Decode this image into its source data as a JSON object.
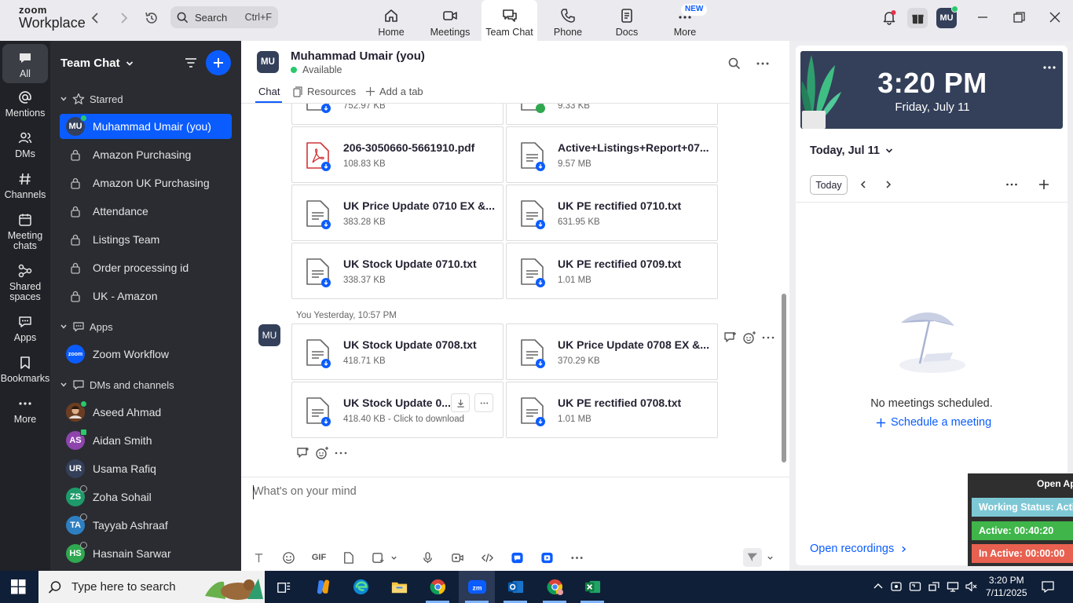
{
  "app": {
    "logo_line1": "zoom",
    "logo_line2": "Workplace",
    "search_placeholder": "Search",
    "search_shortcut": "Ctrl+F",
    "nav": [
      {
        "label": "Home",
        "icon": "home-icon"
      },
      {
        "label": "Meetings",
        "icon": "video-icon"
      },
      {
        "label": "Team Chat",
        "icon": "chat-icon",
        "active": true
      },
      {
        "label": "Phone",
        "icon": "phone-icon"
      },
      {
        "label": "Docs",
        "icon": "docs-icon"
      },
      {
        "label": "More",
        "icon": "more-icon",
        "badge": "NEW"
      }
    ],
    "user_initials": "MU",
    "brand_color": "#0b5cff"
  },
  "rail": {
    "items": [
      {
        "label": "All",
        "icon": "chat-bubble-icon",
        "active": true
      },
      {
        "label": "Mentions",
        "icon": "at-icon"
      },
      {
        "label": "DMs",
        "icon": "people-icon"
      },
      {
        "label": "Channels",
        "icon": "hash-icon"
      },
      {
        "label": "Meeting chats",
        "icon": "calendar-chat-icon"
      },
      {
        "label": "Shared spaces",
        "icon": "shared-spaces-icon"
      },
      {
        "label": "Apps",
        "icon": "apps-icon"
      },
      {
        "label": "Bookmarks",
        "icon": "bookmark-icon"
      },
      {
        "label": "More",
        "icon": "more-dots-icon"
      }
    ]
  },
  "sidebar": {
    "title": "Team Chat",
    "starred_label": "Starred",
    "starred": [
      {
        "label": "Muhammad Umair (you)",
        "initials": "MU",
        "selected": true
      }
    ],
    "channels": [
      {
        "label": "Amazon Purchasing"
      },
      {
        "label": "Amazon UK Purchasing"
      },
      {
        "label": "Attendance"
      },
      {
        "label": "Listings Team"
      },
      {
        "label": "Order processing id"
      },
      {
        "label": "UK - Amazon"
      }
    ],
    "apps_label": "Apps",
    "apps": [
      {
        "label": "Zoom Workflow",
        "initials": "zoom"
      }
    ],
    "dms_label": "DMs and channels",
    "dms": [
      {
        "label": "Aseed Ahmad",
        "initials": "",
        "color": "#7a4a2a",
        "online": true
      },
      {
        "label": "Aidan Smith",
        "initials": "AS",
        "color": "#8e44ad",
        "online": true
      },
      {
        "label": "Usama Rafiq",
        "initials": "UR",
        "color": "#34405a",
        "online": false
      },
      {
        "label": "Zoha Sohail",
        "initials": "ZS",
        "color": "#1e9a6a",
        "online": false
      },
      {
        "label": "Tayyab Ashraaf",
        "initials": "TA",
        "color": "#2d7fc1",
        "online": false
      },
      {
        "label": "Hasnain Sarwar",
        "initials": "HS",
        "color": "#2fa84f",
        "online": false
      }
    ]
  },
  "chat": {
    "avatar": "MU",
    "name": "Muhammad Umair (you)",
    "status": "Available",
    "tabs": [
      "Chat",
      "Resources",
      "Add a tab"
    ],
    "files_top": [
      {
        "name": "",
        "size": "752.97 KB",
        "type": "txt"
      },
      {
        "name": "",
        "size": "9.33 KB",
        "type": "txt"
      },
      {
        "name": "206-3050660-5661910.pdf",
        "size": "108.83 KB",
        "type": "pdf"
      },
      {
        "name": "Active+Listings+Report+07...",
        "size": "9.57 MB",
        "type": "txt"
      },
      {
        "name": "UK Price Update 0710 EX &...",
        "size": "383.28 KB",
        "type": "txt"
      },
      {
        "name": "UK PE rectified 0710.txt",
        "size": "631.95 KB",
        "type": "txt"
      },
      {
        "name": "UK Stock Update 0710.txt",
        "size": "338.37 KB",
        "type": "txt"
      },
      {
        "name": "UK PE rectified 0709.txt",
        "size": "1.01 MB",
        "type": "txt"
      }
    ],
    "message_meta": "You Yesterday, 10:57 PM",
    "message_avatar": "MU",
    "files_msg": [
      {
        "name": "UK Stock Update 0708.txt",
        "size": "418.71 KB"
      },
      {
        "name": "UK Price Update 0708 EX &...",
        "size": "370.29 KB"
      },
      {
        "name": "UK Stock Update 0...",
        "size": "418.40 KB - Click to download"
      },
      {
        "name": "UK PE rectified 0708.txt",
        "size": "1.01 MB"
      }
    ],
    "composer_placeholder": "What's on your mind",
    "composer_gif": "GIF"
  },
  "calendar": {
    "time": "3:20 PM",
    "date": "Friday, July 11",
    "header": "Today, Jul 11",
    "today_button": "Today",
    "empty_text": "No meetings scheduled.",
    "schedule_link": "Schedule a meeting",
    "recordings_link": "Open recordings"
  },
  "widget": {
    "header": "Open Ap",
    "rows": [
      {
        "label": "Working Status: Active",
        "color": "#7ec8d6"
      },
      {
        "label": "Active: 00:40:20",
        "color": "#3fb54a"
      },
      {
        "label": "In Active: 00:00:00",
        "color": "#e8604f"
      }
    ]
  },
  "taskbar": {
    "search_placeholder": "Type here to search",
    "time": "3:20 PM",
    "date": "7/11/2025"
  }
}
